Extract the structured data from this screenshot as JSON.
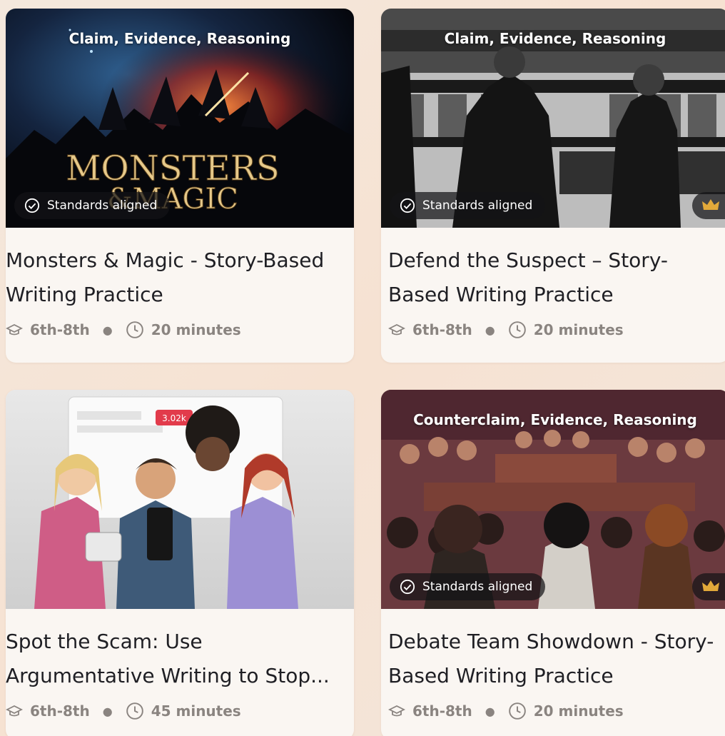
{
  "cards": [
    {
      "topic": "Claim, Evidence, Reasoning",
      "cover_text": "MONSTERS & MAGIC",
      "badge": "Standards aligned",
      "premium": false,
      "title": "Monsters & Magic - Story-Based Writing Practice",
      "grade": "6th-8th",
      "duration": "20 minutes"
    },
    {
      "topic": "Claim, Evidence, Reasoning",
      "badge": "Standards aligned",
      "premium": true,
      "title": "Defend the Suspect – Story-Based Writing Practice",
      "grade": "6th-8th",
      "duration": "20 minutes"
    },
    {
      "topic": "",
      "screen_text": "3.02k",
      "badge": "",
      "premium": false,
      "title": "Spot the Scam: Use Argumentative Writing to Stop...",
      "grade": "6th-8th",
      "duration": "45 minutes"
    },
    {
      "topic": "Counterclaim, Evidence, Reasoning",
      "badge": "Standards aligned",
      "premium": true,
      "title": "Debate Team Showdown - Story-Based Writing Practice",
      "grade": "6th-8th",
      "duration": "20 minutes"
    }
  ],
  "icons": {
    "badge": "check-circle-icon",
    "grade": "graduation-cap-icon",
    "duration": "clock-icon",
    "premium": "crown-icon"
  },
  "colors": {
    "crown": "#e2a93a",
    "meta_text": "#8a8480",
    "title_text": "#1f1f24",
    "card_bg": "#faf6f2"
  }
}
